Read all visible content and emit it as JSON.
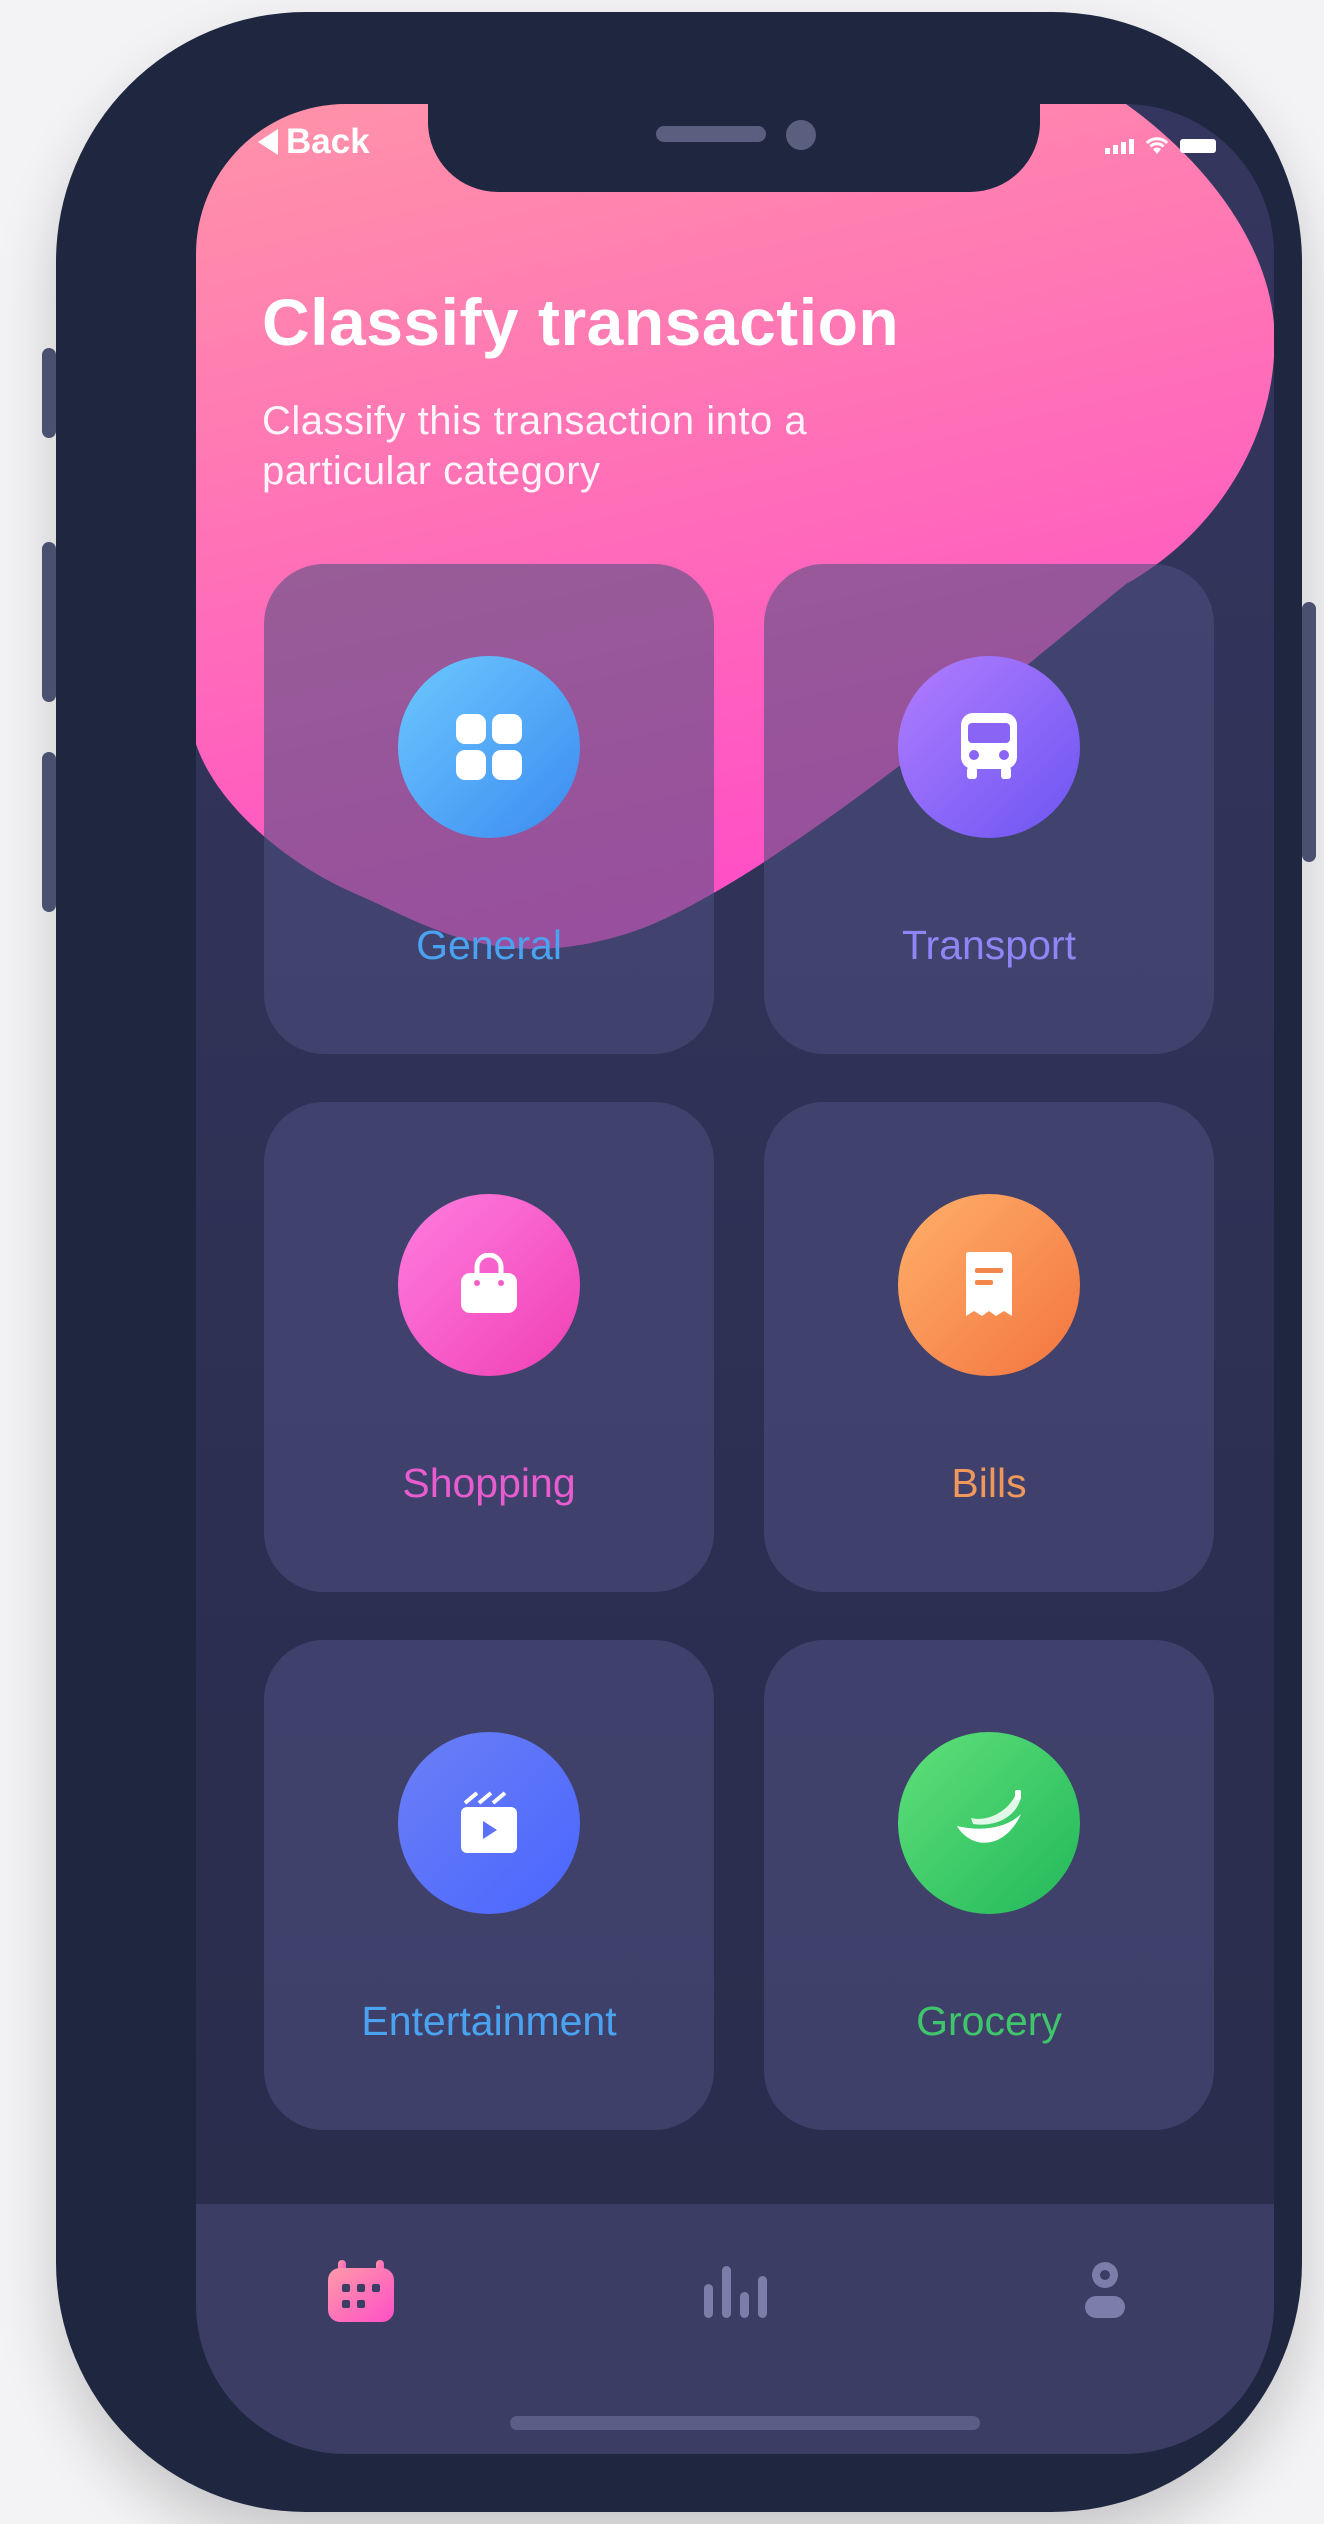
{
  "header": {
    "back_label": "Back",
    "title": "Classify transaction",
    "subtitle": "Classify this transaction into a particular category"
  },
  "categories": [
    {
      "label": "General",
      "icon": "grid-icon",
      "color": "#4aa3f0",
      "gradient": [
        "#6dc8ff",
        "#3b8bf0"
      ]
    },
    {
      "label": "Transport",
      "icon": "bus-icon",
      "color": "#8f86f5",
      "gradient": [
        "#b27dff",
        "#6b55f2"
      ]
    },
    {
      "label": "Shopping",
      "icon": "shopping-bag-icon",
      "color": "#e85ccf",
      "gradient": [
        "#ff7ee0",
        "#f03fb4"
      ]
    },
    {
      "label": "Bills",
      "icon": "receipt-icon",
      "color": "#f0985c",
      "gradient": [
        "#ffb06a",
        "#f3743f"
      ]
    },
    {
      "label": "Entertainment",
      "icon": "clapperboard-icon",
      "color": "#4aa3f0",
      "gradient": [
        "#6b7ff5",
        "#4a66ff"
      ]
    },
    {
      "label": "Grocery",
      "icon": "banana-icon",
      "color": "#3fc66b",
      "gradient": [
        "#5fe07a",
        "#22b85a"
      ]
    }
  ],
  "tabbar": {
    "items": [
      {
        "icon": "calendar-icon",
        "active": true,
        "color": "#ff6fb2"
      },
      {
        "icon": "bar-chart-icon",
        "active": false,
        "color": "#7b7ea8"
      },
      {
        "icon": "user-icon",
        "active": false,
        "color": "#7b7ea8"
      }
    ]
  },
  "theme": {
    "header_gradient": [
      "#ff93a8",
      "#ff5cc3"
    ],
    "background": "#2e3054"
  }
}
